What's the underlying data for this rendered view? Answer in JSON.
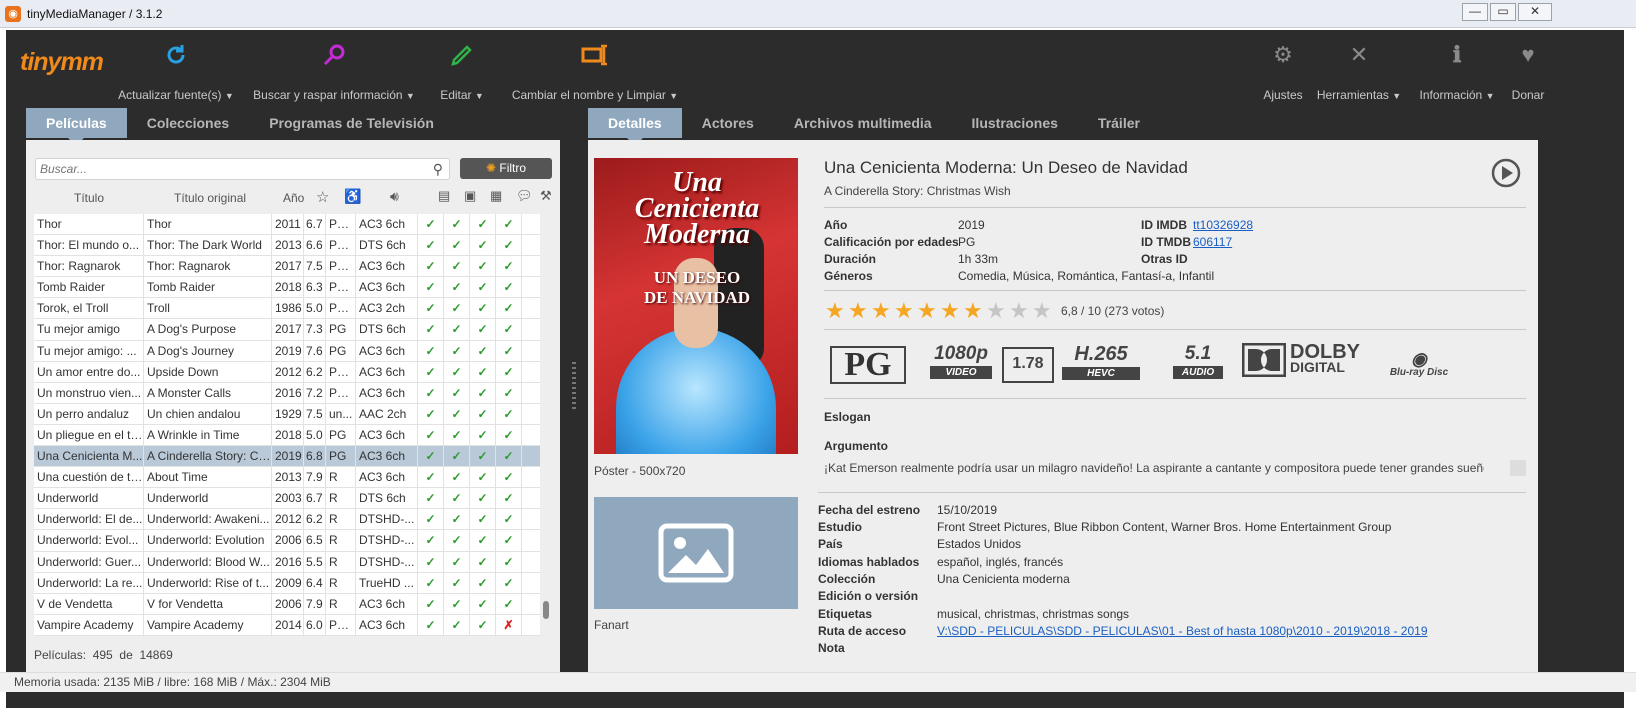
{
  "window": {
    "title": "tinyMediaManager / 3.1.2"
  },
  "toolbar": {
    "logo": "tinymm",
    "buttons": [
      {
        "label": "Actualizar fuente(s)",
        "icon": "refresh-icon",
        "color": "#2aa0e0"
      },
      {
        "label": "Buscar y raspar información",
        "icon": "search-scrape-icon",
        "color": "#c42bd6"
      },
      {
        "label": "Editar",
        "icon": "edit-icon",
        "color": "#2fb34a"
      },
      {
        "label": "Cambiar el nombre y Limpiar",
        "icon": "rename-icon",
        "color": "#f08a1c"
      }
    ],
    "right": [
      {
        "label": "Ajustes",
        "icon": "gear-icon"
      },
      {
        "label": "Herramientas",
        "icon": "tools-icon"
      },
      {
        "label": "Información",
        "icon": "info-icon"
      },
      {
        "label": "Donar",
        "icon": "heart-icon"
      }
    ]
  },
  "left_tabs": [
    "Películas",
    "Colecciones",
    "Programas de Televisión"
  ],
  "right_tabs": [
    "Detalles",
    "Actores",
    "Archivos multimedia",
    "Ilustraciones",
    "Tráiler"
  ],
  "search": {
    "placeholder": "Buscar..."
  },
  "filter_label": "Filtro",
  "columns": {
    "title": "Título",
    "original": "Título original",
    "year": "Año"
  },
  "movies": [
    {
      "title": "Thor",
      "original": "Thor",
      "year": "2011",
      "rating": "6.7",
      "cert": "PG...",
      "audio": "AC3 6ch",
      "checks": [
        "✓",
        "✓",
        "✓",
        "✓"
      ]
    },
    {
      "title": "Thor: El mundo o...",
      "original": "Thor: The Dark World",
      "year": "2013",
      "rating": "6.6",
      "cert": "PG...",
      "audio": "DTS 6ch",
      "checks": [
        "✓",
        "✓",
        "✓",
        "✓"
      ]
    },
    {
      "title": "Thor: Ragnarok",
      "original": "Thor: Ragnarok",
      "year": "2017",
      "rating": "7.5",
      "cert": "PG...",
      "audio": "AC3 6ch",
      "checks": [
        "✓",
        "✓",
        "✓",
        "✓"
      ]
    },
    {
      "title": "Tomb Raider",
      "original": "Tomb Raider",
      "year": "2018",
      "rating": "6.3",
      "cert": "PG...",
      "audio": "AC3 6ch",
      "checks": [
        "✓",
        "✓",
        "✓",
        "✓"
      ]
    },
    {
      "title": "Torok, el Troll",
      "original": "Troll",
      "year": "1986",
      "rating": "5.0",
      "cert": "PG...",
      "audio": "AC3 2ch",
      "checks": [
        "✓",
        "✓",
        "✓",
        "✓"
      ]
    },
    {
      "title": "Tu mejor amigo",
      "original": "A Dog's Purpose",
      "year": "2017",
      "rating": "7.3",
      "cert": "PG",
      "audio": "DTS 6ch",
      "checks": [
        "✓",
        "✓",
        "✓",
        "✓"
      ]
    },
    {
      "title": "Tu mejor amigo: ...",
      "original": "A Dog's Journey",
      "year": "2019",
      "rating": "7.6",
      "cert": "PG",
      "audio": "AC3 6ch",
      "checks": [
        "✓",
        "✓",
        "✓",
        "✓"
      ]
    },
    {
      "title": "Un amor entre do...",
      "original": "Upside Down",
      "year": "2012",
      "rating": "6.2",
      "cert": "PG...",
      "audio": "AC3 6ch",
      "checks": [
        "✓",
        "✓",
        "✓",
        "✓"
      ]
    },
    {
      "title": "Un monstruo vien...",
      "original": "A Monster Calls",
      "year": "2016",
      "rating": "7.2",
      "cert": "PG...",
      "audio": "AC3 6ch",
      "checks": [
        "✓",
        "✓",
        "✓",
        "✓"
      ]
    },
    {
      "title": "Un perro andaluz",
      "original": "Un chien andalou",
      "year": "1929",
      "rating": "7.5",
      "cert": "un...",
      "audio": "AAC 2ch",
      "checks": [
        "✓",
        "✓",
        "✓",
        "✓"
      ]
    },
    {
      "title": "Un pliegue en el ti...",
      "original": "A Wrinkle in Time",
      "year": "2018",
      "rating": "5.0",
      "cert": "PG",
      "audio": "AC3 6ch",
      "checks": [
        "✓",
        "✓",
        "✓",
        "✓"
      ]
    },
    {
      "title": "Una Cenicienta M...",
      "original": "A Cinderella Story: Ch...",
      "year": "2019",
      "rating": "6.8",
      "cert": "PG",
      "audio": "AC3 6ch",
      "checks": [
        "✓",
        "✓",
        "✓",
        "✓"
      ],
      "selected": true
    },
    {
      "title": "Una cuestión de ti...",
      "original": "About Time",
      "year": "2013",
      "rating": "7.9",
      "cert": "R",
      "audio": "AC3 6ch",
      "checks": [
        "✓",
        "✓",
        "✓",
        "✓"
      ]
    },
    {
      "title": "Underworld",
      "original": "Underworld",
      "year": "2003",
      "rating": "6.7",
      "cert": "R",
      "audio": "DTS 6ch",
      "checks": [
        "✓",
        "✓",
        "✓",
        "✓"
      ]
    },
    {
      "title": "Underworld: El de...",
      "original": "Underworld: Awakeni...",
      "year": "2012",
      "rating": "6.2",
      "cert": "R",
      "audio": "DTSHD-...",
      "checks": [
        "✓",
        "✓",
        "✓",
        "✓"
      ]
    },
    {
      "title": "Underworld: Evol...",
      "original": "Underworld: Evolution",
      "year": "2006",
      "rating": "6.5",
      "cert": "R",
      "audio": "DTSHD-...",
      "checks": [
        "✓",
        "✓",
        "✓",
        "✓"
      ]
    },
    {
      "title": "Underworld: Guer...",
      "original": "Underworld: Blood W...",
      "year": "2016",
      "rating": "5.5",
      "cert": "R",
      "audio": "DTSHD-...",
      "checks": [
        "✓",
        "✓",
        "✓",
        "✓"
      ]
    },
    {
      "title": "Underworld: La re...",
      "original": "Underworld: Rise of t...",
      "year": "2009",
      "rating": "6.4",
      "cert": "R",
      "audio": "TrueHD ...",
      "checks": [
        "✓",
        "✓",
        "✓",
        "✓"
      ]
    },
    {
      "title": "V de Vendetta",
      "original": "V for Vendetta",
      "year": "2006",
      "rating": "7.9",
      "cert": "R",
      "audio": "AC3 6ch",
      "checks": [
        "✓",
        "✓",
        "✓",
        "✓"
      ]
    },
    {
      "title": "Vampire Academy",
      "original": "Vampire Academy",
      "year": "2014",
      "rating": "6.0",
      "cert": "PG...",
      "audio": "AC3 6ch",
      "checks": [
        "✓",
        "✓",
        "✓",
        "✗"
      ]
    }
  ],
  "count": {
    "label": "Películas:",
    "shown": "495",
    "sep": "de",
    "total": "14869"
  },
  "status": "Memoria usada: 2135 MiB  /  libre: 168 MiB  /  Máx.: 2304 MiB",
  "detail": {
    "title": "Una Cenicienta Moderna: Un Deseo de Navidad",
    "original": "A Cinderella Story: Christmas Wish",
    "poster_title_1": "Una",
    "poster_title_2": "Cenicienta",
    "poster_title_3": "Moderna",
    "poster_sub_1": "UN DESEO",
    "poster_sub_2": "DE NAVIDAD",
    "poster_caption": "Póster - 500x720",
    "fanart_caption": "Fanart",
    "year_label": "Año",
    "year": "2019",
    "cert_label": "Calificación por edades",
    "cert": "PG",
    "runtime_label": "Duración",
    "runtime": "1h 33m",
    "genres_label": "Géneros",
    "genres": "Comedia, Música, Romántica, Fantasí-a, Infantil",
    "imdb_label": "ID IMDB",
    "imdb": "tt10326928",
    "tmdb_label": "ID TMDB",
    "tmdb": "606117",
    "other_ids_label": "Otras ID",
    "rating_value": 6.8,
    "rating_text": "6,8 / 10   (273 votos)",
    "media": {
      "cert": "PG",
      "res": "1080p",
      "res_sub": "VIDEO",
      "aspect": "1.78",
      "codec": "H.265",
      "codec_sub": "HEVC",
      "channels": "5.1",
      "channels_sub": "AUDIO",
      "audio_brand": "DOLBY",
      "audio_brand_sub": "DIGITAL",
      "source": "Blu-ray Disc"
    },
    "tagline_label": "Eslogan",
    "plot_label": "Argumento",
    "plot": "¡Kat Emerson realmente podría usar un milagro navideño! La aspirante a cantante y compositora puede tener grandes sueños,",
    "release_label": "Fecha del estreno",
    "release": "15/10/2019",
    "studio_label": "Estudio",
    "studio": "Front Street Pictures, Blue Ribbon Content, Warner Bros. Home Entertainment Group",
    "country_label": "País",
    "country": "Estados Unidos",
    "languages_label": "Idiomas hablados",
    "languages": "español, inglés, francés",
    "collection_label": "Colección",
    "collection": "Una Cenicienta moderna",
    "edition_label": "Edición o versión",
    "tags_label": "Etiquetas",
    "tags": "musical, christmas, christmas songs",
    "path_label": "Ruta de acceso",
    "path": "V:\\SDD - PELICULAS\\SDD - PELICULAS\\01 - Best of hasta 1080p\\2010 - 2019\\2018 - 2019",
    "note_label": "Nota"
  }
}
